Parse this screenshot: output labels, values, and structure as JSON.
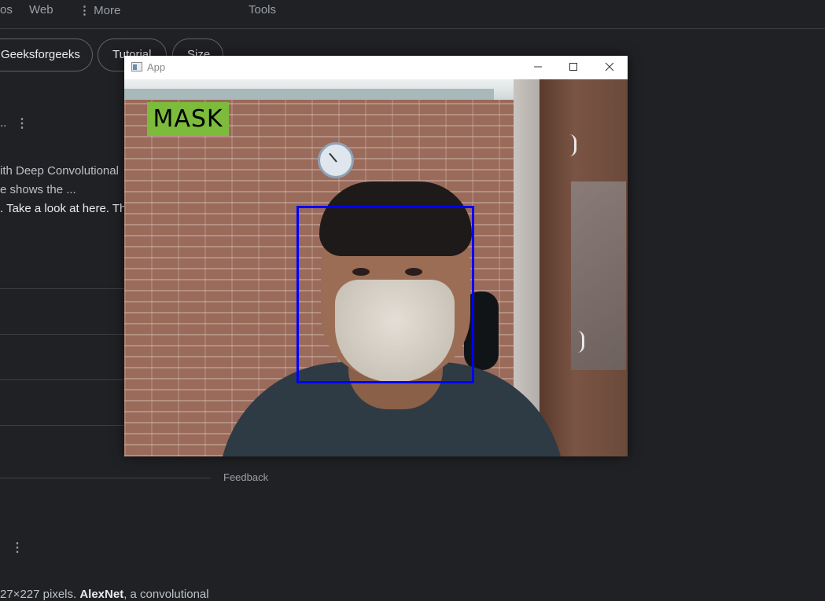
{
  "search_page": {
    "nav": {
      "images_partial": "os",
      "web": "Web",
      "more": "More",
      "more_icon": "vertical-dots-icon",
      "tools": "Tools"
    },
    "chips": [
      "Geeksforgeeks",
      "Tutorial",
      "Size"
    ],
    "snippet_lines": [
      "ith Deep Convolutional",
      "e shows the ...",
      ". Take a look at here. Th"
    ],
    "ellipsis": "..",
    "feedback": "Feedback",
    "bottom_snippet": {
      "prefix": "27×227 pixels. ",
      "bold": "AlexNet",
      "suffix": ", a convolutional"
    }
  },
  "window": {
    "title": "App",
    "icon": "app-window-icon",
    "controls": [
      "minimize-icon",
      "maximize-icon",
      "close-icon"
    ]
  },
  "detection": {
    "label": "MASK",
    "label_color": "#7dbb3c",
    "box_color": "#0000ff"
  },
  "colors": {
    "page_bg": "#202124",
    "window_bg": "#ffffff"
  }
}
